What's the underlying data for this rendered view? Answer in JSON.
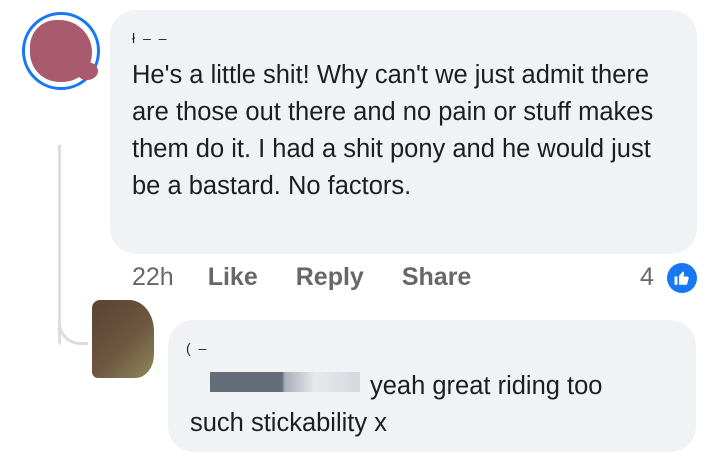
{
  "comment": {
    "author_redacted": "ł – –",
    "text": "He's a little shit! Why can't we just admit there are those out there and no pain or stuff makes them do it. I had a shit pony and he would just be a bastard. No factors.",
    "timestamp": "22h",
    "like_label": "Like",
    "reply_label": "Reply",
    "share_label": "Share",
    "reaction_count": "4",
    "reaction_icon": "like-icon",
    "accent_color": "#1877f2"
  },
  "reply": {
    "author_redacted": "( –",
    "text_line1": "yeah  great riding too",
    "text_line2": "such stickability x"
  }
}
